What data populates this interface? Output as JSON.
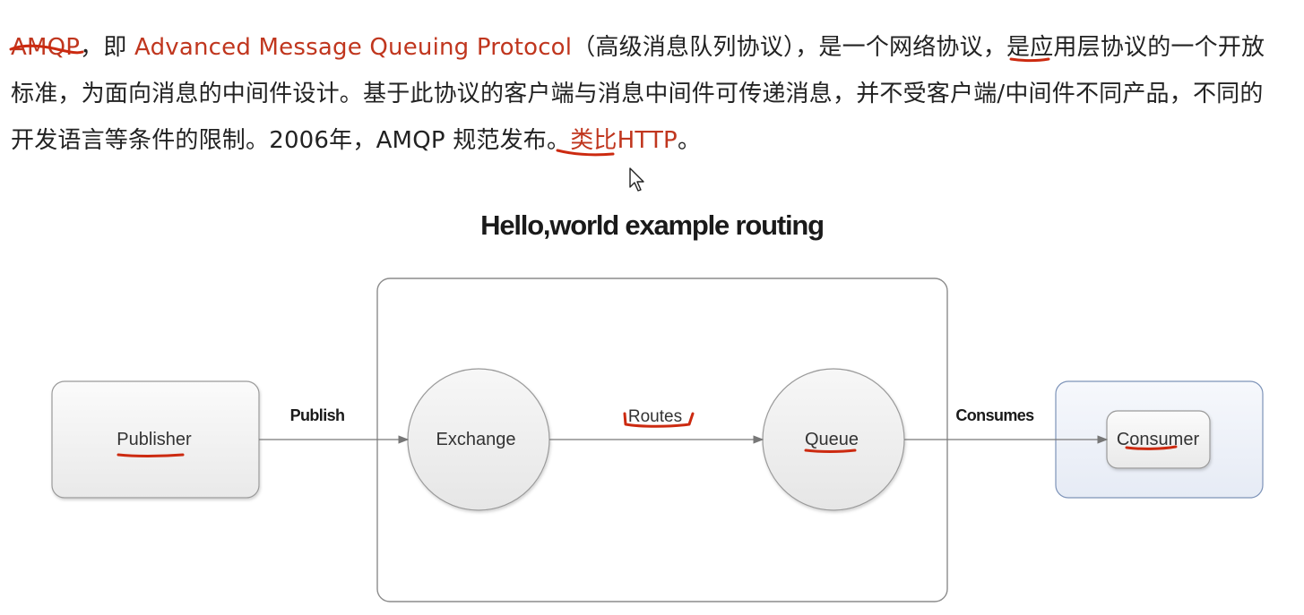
{
  "paragraph": {
    "s1": "AMQP",
    "s2": "，即 ",
    "s3": "Advanced Message Queuing Protocol",
    "s4": "（高级消息队列协议），是一个网络",
    "s5": "协议",
    "s6": "，是应用层协议的一个开放标准，为面向消息的中间件设计。基于此协议的客户端与消息中间件可传递消息，并不受客户端/中间件不同产品，不同的开发语言等条件的限制。",
    "s7": "2006年",
    "s8": "，AMQP 规范发布。",
    "s9": "类比HTTP",
    "s10": "。"
  },
  "diagram": {
    "title": "Hello,world example routing",
    "nodes": {
      "publisher": "Publisher",
      "exchange": "Exchange",
      "queue": "Queue",
      "consumer": "Consumer"
    },
    "edges": {
      "publish": "Publish",
      "routes": "Routes",
      "consumes": "Consumes"
    }
  },
  "colors": {
    "text": "#222222",
    "highlight": "#c0361e",
    "annotation_ink": "#cc2a10",
    "node_border": "#9a9a9a",
    "consumer_group_border": "#7d93b8",
    "consumer_group_fill": "#eef2f9",
    "arrow": "#777777"
  },
  "icons": {
    "cursor": "mouse-pointer-icon"
  }
}
